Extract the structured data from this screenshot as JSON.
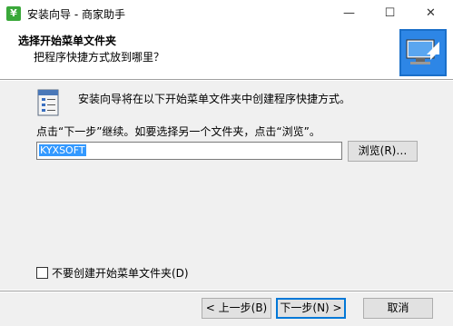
{
  "window": {
    "title": "安装向导 - 商家助手",
    "app_icon_glyph": "¥",
    "controls": {
      "minimize": "—",
      "maximize": "☐",
      "close": "✕"
    }
  },
  "header": {
    "title": "选择开始菜单文件夹",
    "subtitle": "把程序快捷方式放到哪里？"
  },
  "main": {
    "intro": "安装向导将在以下开始菜单文件夹中创建程序快捷方式。",
    "instruction": "点击“下一步”继续。如要选择另一个文件夹，点击“浏览”。",
    "folder_value": "KYXSOFT",
    "browse_label": "浏览(R)…",
    "no_folder_label": "不要创建开始菜单文件夹(D)"
  },
  "footer": {
    "back_label": "< 上一步(B)",
    "next_label": "下一步(N) >",
    "cancel_label": "取消"
  },
  "colors": {
    "accent": "#0078d7",
    "selection": "#3399ff",
    "app_icon": "#3aa83a"
  }
}
